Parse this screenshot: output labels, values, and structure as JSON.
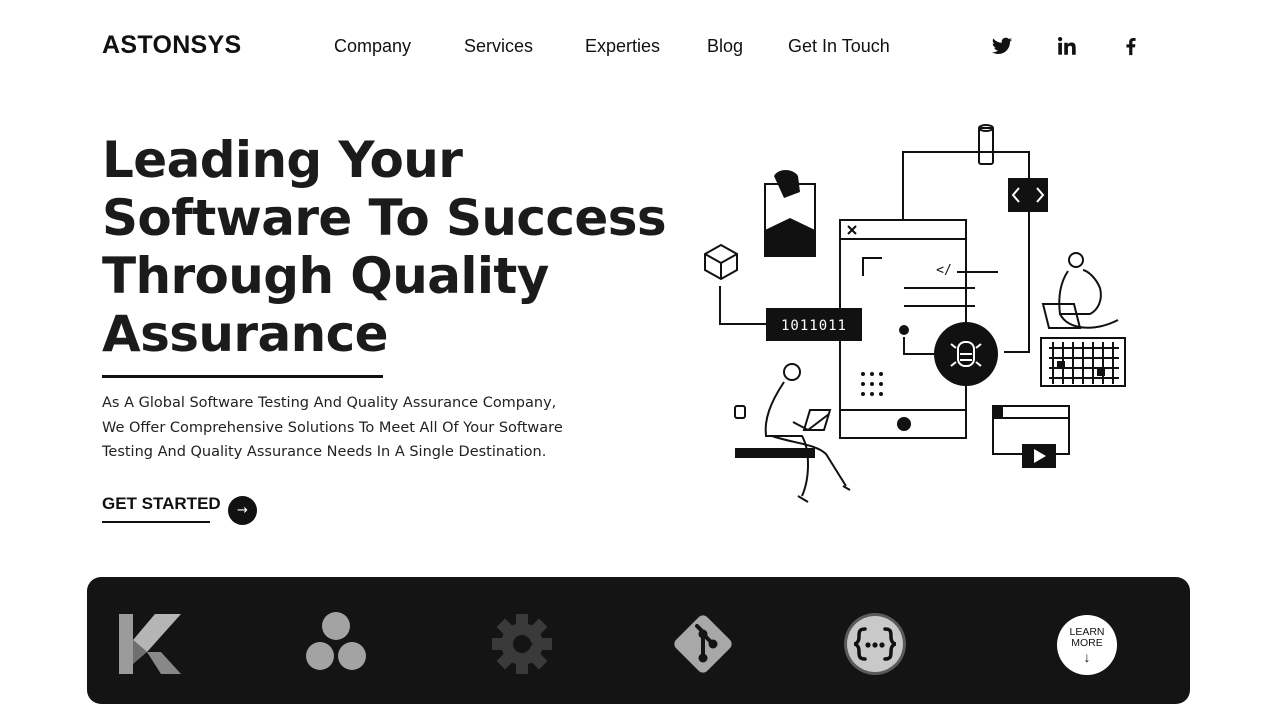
{
  "brand": {
    "name": "ASTONSYS"
  },
  "nav": {
    "items": [
      {
        "label": "Company"
      },
      {
        "label": "Services"
      },
      {
        "label": "Experties"
      },
      {
        "label": "Blog"
      },
      {
        "label": "Get In Touch"
      }
    ]
  },
  "social": {
    "icons": [
      "twitter-icon",
      "linkedin-icon",
      "facebook-icon"
    ]
  },
  "hero": {
    "title_lines": [
      "Leading Your",
      "Software To Success",
      "Through Quality",
      "Assurance"
    ],
    "description_lines": [
      "As A Global Software Testing And Quality Assurance Company,",
      "We Offer Comprehensive Solutions To Meet All Of Your Software",
      "Testing And Quality Assurance Needs In A Single Destination."
    ],
    "cta_label": "GET STARTED",
    "cta_icon": "arrow-right-icon"
  },
  "illustration": {
    "binary_text": "1011011",
    "code_snippet": "</"
  },
  "tools": {
    "icons": [
      "katalon-icon",
      "asana-icon",
      "settings-gear-icon",
      "git-icon",
      "api-braces-icon"
    ],
    "learn_more_line1": "LEARN",
    "learn_more_line2": "MORE",
    "learn_more_arrow": "↓"
  },
  "colors": {
    "background": "#ffffff",
    "text": "#111111",
    "dark_band": "#141414",
    "icon_gray": "#a0a0a0"
  }
}
